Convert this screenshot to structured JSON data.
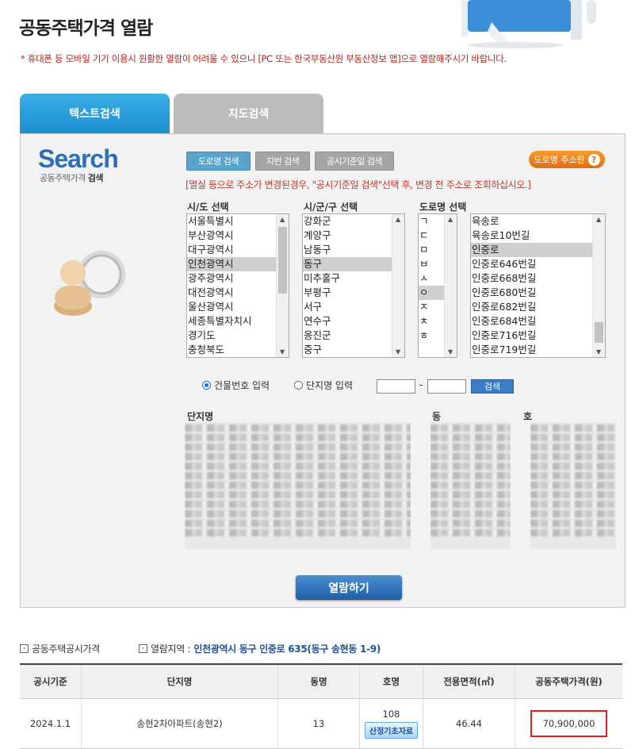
{
  "page": {
    "title": "공동주택가격 열람",
    "notice": "* 휴대폰 등 모바일 기기 이용시 원활한 열람이 어려울 수 있으니 [PC 또는 한국부동산원 부동산정보 앱]으로 열람해주시기 바랍니다."
  },
  "tabs": {
    "text_search": "텍스트검색",
    "map_search": "지도검색"
  },
  "search_logo": {
    "title": "Search",
    "sub_prefix": "공동주택가격 ",
    "sub_bold": "검색"
  },
  "search_types": {
    "road": "도로명 검색",
    "lot": "지번 검색",
    "date": "공시기준일 검색"
  },
  "guide_button": {
    "label": "도로명 주소란",
    "icon": "?"
  },
  "warning": "[멸실 등으로 주소가 변경된경우, \"공시기준일 검색\"선택 후, 변경 전 주소로 조회하십시오.]",
  "selectors": {
    "sido_label": "시/도 선택",
    "sigungu_label": "시/군/구 선택",
    "road_label": "도로명 선택",
    "sido": [
      "서울특별시",
      "부산광역시",
      "대구광역시",
      "인천광역시",
      "광주광역시",
      "대전광역시",
      "울산광역시",
      "세종특별자치시",
      "경기도",
      "충청북도"
    ],
    "sido_selected": "인천광역시",
    "sigungu": [
      "강화군",
      "계양구",
      "남동구",
      "동구",
      "미추홀구",
      "부평구",
      "서구",
      "연수구",
      "옹진군",
      "중구"
    ],
    "sigungu_selected": "동구",
    "initials": [
      "ㄱ",
      "ㄷ",
      "ㅁ",
      "ㅂ",
      "ㅅ",
      "ㅇ",
      "ㅈ",
      "ㅊ",
      "ㅎ"
    ],
    "initial_selected": "ㅇ",
    "roads": [
      "육송로",
      "육송로10번길",
      "인중로",
      "인중로646번길",
      "인중로668번길",
      "인중로680번길",
      "인중로682번길",
      "인중로684번길",
      "인중로716번길",
      "인중로719번길"
    ],
    "road_selected": "인중로"
  },
  "input_mode": {
    "building": "건물번호 입력",
    "complex": "단지명 입력",
    "search_button": "검색",
    "dash": "-"
  },
  "columns": {
    "complex": "단지명",
    "dong": "동",
    "ho": "호"
  },
  "view_button": "열람하기",
  "result": {
    "label": "공동주택공시가격",
    "region_label": "열람지역 : ",
    "region_value": "인천광역시 동구 인중로 635(동구 송현동 1-9)",
    "headers": [
      "공시기준",
      "단지명",
      "동명",
      "호명",
      "전용면적(㎡)",
      "공동주택가격(원)"
    ],
    "row": {
      "date": "2024.1.1",
      "complex": "송현2차아파트(송현2)",
      "dong": "13",
      "ho": "108",
      "data_button": "산정기초자료",
      "area": "46.44",
      "price": "70,900,000"
    }
  },
  "colors": {
    "accent": "#1d8fd0",
    "warning": "#c0392b",
    "highlight": "#e02020"
  }
}
